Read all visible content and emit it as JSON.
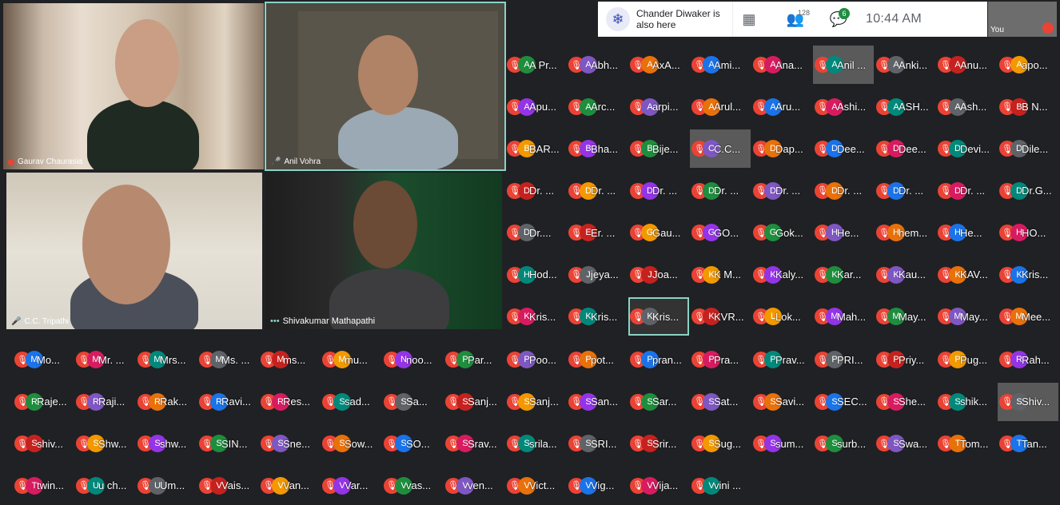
{
  "videos": [
    {
      "name": "Gaurav Chaurasia"
    },
    {
      "name": "Anil Vohra"
    },
    {
      "name": "C.C. Tripathi"
    },
    {
      "name": "Shivakumar Mathapathi"
    }
  ],
  "topbar": {
    "notification": "Chander Diwaker is also here",
    "participants_count": "128",
    "chat_badge": "6",
    "time": "10:44 AM",
    "you_label": "You"
  },
  "colors": {
    "mic_off": "#ea4335",
    "active_border": "#8ad3c5",
    "background": "#202124"
  },
  "grid_top": [
    [
      "A Pr...",
      "Abh...",
      "AxA...",
      "Ami...",
      "Ana...",
      "Anil ...",
      "Anki...",
      "Anu...",
      "apo..."
    ],
    [
      "Apu...",
      "Arc...",
      "arpi...",
      "Arul...",
      "Aru...",
      "Ashi...",
      "ASH...",
      "Ash...",
      "B N..."
    ],
    [
      "BAR...",
      "Bha...",
      "Bije...",
      "C.C...",
      "Dap...",
      "Dee...",
      "Dee...",
      "Devi...",
      "Dile..."
    ],
    [
      "Dr. ...",
      "Dr. ...",
      "Dr. ...",
      "Dr. ...",
      "Dr. ...",
      "Dr. ...",
      "Dr. ...",
      "Dr. ...",
      "Dr.G..."
    ],
    [
      "Dr....",
      "Er. ...",
      "Gau...",
      "GO...",
      "Gok...",
      "He...",
      "hem...",
      "He...",
      "HO..."
    ],
    [
      "Hod...",
      "jeya...",
      "Joa...",
      "K M...",
      "Kaly...",
      "Kar...",
      "Kau...",
      "KAV...",
      "Kris..."
    ],
    [
      "Kris...",
      "Kris...",
      "Kris...",
      "KVR...",
      "Lok...",
      "Mah...",
      "May...",
      "May...",
      "Mee..."
    ]
  ],
  "grid_bottom": [
    [
      "Mo...",
      "Mr. ...",
      "Mrs...",
      "Ms. ...",
      "ms...",
      "mu...",
      "noo...",
      "Par...",
      "Poo...",
      "pot...",
      "pran...",
      "Pra...",
      "Prav...",
      "PRI...",
      "Priy...",
      "Pug...",
      "Rah..."
    ],
    [
      "Raje...",
      "Raji...",
      "Rak...",
      "Ravi...",
      "Res...",
      "sad...",
      "Sa...",
      "Sanj...",
      "Sanj...",
      "San...",
      "Sar...",
      "Sat...",
      "Savi...",
      "SEC...",
      "She...",
      "shik...",
      "Shiv..."
    ],
    [
      "shiv...",
      "Shw...",
      "shw...",
      "SIN...",
      "Sne...",
      "Sow...",
      "SO...",
      "Srav...",
      "srila...",
      "SRI...",
      "Srir...",
      "Sug...",
      "sum...",
      "surb...",
      "Swa...",
      "Tom...",
      "Tan..."
    ],
    [
      "twin...",
      "u ch...",
      "Um...",
      "Vais...",
      "Van...",
      "Var...",
      "vas...",
      "ven...",
      "Vict...",
      "Vig...",
      "Vija...",
      "vini ..."
    ]
  ]
}
